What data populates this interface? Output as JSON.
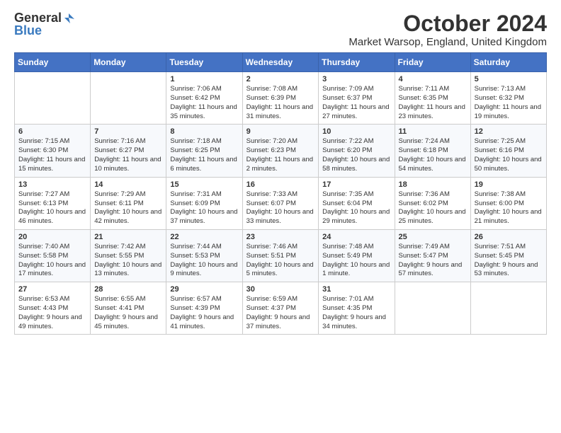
{
  "logo": {
    "general": "General",
    "blue": "Blue"
  },
  "title": "October 2024",
  "subtitle": "Market Warsop, England, United Kingdom",
  "days_of_week": [
    "Sunday",
    "Monday",
    "Tuesday",
    "Wednesday",
    "Thursday",
    "Friday",
    "Saturday"
  ],
  "weeks": [
    [
      {
        "day": "",
        "info": ""
      },
      {
        "day": "",
        "info": ""
      },
      {
        "day": "1",
        "info": "Sunrise: 7:06 AM\nSunset: 6:42 PM\nDaylight: 11 hours and 35 minutes."
      },
      {
        "day": "2",
        "info": "Sunrise: 7:08 AM\nSunset: 6:39 PM\nDaylight: 11 hours and 31 minutes."
      },
      {
        "day": "3",
        "info": "Sunrise: 7:09 AM\nSunset: 6:37 PM\nDaylight: 11 hours and 27 minutes."
      },
      {
        "day": "4",
        "info": "Sunrise: 7:11 AM\nSunset: 6:35 PM\nDaylight: 11 hours and 23 minutes."
      },
      {
        "day": "5",
        "info": "Sunrise: 7:13 AM\nSunset: 6:32 PM\nDaylight: 11 hours and 19 minutes."
      }
    ],
    [
      {
        "day": "6",
        "info": "Sunrise: 7:15 AM\nSunset: 6:30 PM\nDaylight: 11 hours and 15 minutes."
      },
      {
        "day": "7",
        "info": "Sunrise: 7:16 AM\nSunset: 6:27 PM\nDaylight: 11 hours and 10 minutes."
      },
      {
        "day": "8",
        "info": "Sunrise: 7:18 AM\nSunset: 6:25 PM\nDaylight: 11 hours and 6 minutes."
      },
      {
        "day": "9",
        "info": "Sunrise: 7:20 AM\nSunset: 6:23 PM\nDaylight: 11 hours and 2 minutes."
      },
      {
        "day": "10",
        "info": "Sunrise: 7:22 AM\nSunset: 6:20 PM\nDaylight: 10 hours and 58 minutes."
      },
      {
        "day": "11",
        "info": "Sunrise: 7:24 AM\nSunset: 6:18 PM\nDaylight: 10 hours and 54 minutes."
      },
      {
        "day": "12",
        "info": "Sunrise: 7:25 AM\nSunset: 6:16 PM\nDaylight: 10 hours and 50 minutes."
      }
    ],
    [
      {
        "day": "13",
        "info": "Sunrise: 7:27 AM\nSunset: 6:13 PM\nDaylight: 10 hours and 46 minutes."
      },
      {
        "day": "14",
        "info": "Sunrise: 7:29 AM\nSunset: 6:11 PM\nDaylight: 10 hours and 42 minutes."
      },
      {
        "day": "15",
        "info": "Sunrise: 7:31 AM\nSunset: 6:09 PM\nDaylight: 10 hours and 37 minutes."
      },
      {
        "day": "16",
        "info": "Sunrise: 7:33 AM\nSunset: 6:07 PM\nDaylight: 10 hours and 33 minutes."
      },
      {
        "day": "17",
        "info": "Sunrise: 7:35 AM\nSunset: 6:04 PM\nDaylight: 10 hours and 29 minutes."
      },
      {
        "day": "18",
        "info": "Sunrise: 7:36 AM\nSunset: 6:02 PM\nDaylight: 10 hours and 25 minutes."
      },
      {
        "day": "19",
        "info": "Sunrise: 7:38 AM\nSunset: 6:00 PM\nDaylight: 10 hours and 21 minutes."
      }
    ],
    [
      {
        "day": "20",
        "info": "Sunrise: 7:40 AM\nSunset: 5:58 PM\nDaylight: 10 hours and 17 minutes."
      },
      {
        "day": "21",
        "info": "Sunrise: 7:42 AM\nSunset: 5:55 PM\nDaylight: 10 hours and 13 minutes."
      },
      {
        "day": "22",
        "info": "Sunrise: 7:44 AM\nSunset: 5:53 PM\nDaylight: 10 hours and 9 minutes."
      },
      {
        "day": "23",
        "info": "Sunrise: 7:46 AM\nSunset: 5:51 PM\nDaylight: 10 hours and 5 minutes."
      },
      {
        "day": "24",
        "info": "Sunrise: 7:48 AM\nSunset: 5:49 PM\nDaylight: 10 hours and 1 minute."
      },
      {
        "day": "25",
        "info": "Sunrise: 7:49 AM\nSunset: 5:47 PM\nDaylight: 9 hours and 57 minutes."
      },
      {
        "day": "26",
        "info": "Sunrise: 7:51 AM\nSunset: 5:45 PM\nDaylight: 9 hours and 53 minutes."
      }
    ],
    [
      {
        "day": "27",
        "info": "Sunrise: 6:53 AM\nSunset: 4:43 PM\nDaylight: 9 hours and 49 minutes."
      },
      {
        "day": "28",
        "info": "Sunrise: 6:55 AM\nSunset: 4:41 PM\nDaylight: 9 hours and 45 minutes."
      },
      {
        "day": "29",
        "info": "Sunrise: 6:57 AM\nSunset: 4:39 PM\nDaylight: 9 hours and 41 minutes."
      },
      {
        "day": "30",
        "info": "Sunrise: 6:59 AM\nSunset: 4:37 PM\nDaylight: 9 hours and 37 minutes."
      },
      {
        "day": "31",
        "info": "Sunrise: 7:01 AM\nSunset: 4:35 PM\nDaylight: 9 hours and 34 minutes."
      },
      {
        "day": "",
        "info": ""
      },
      {
        "day": "",
        "info": ""
      }
    ]
  ]
}
